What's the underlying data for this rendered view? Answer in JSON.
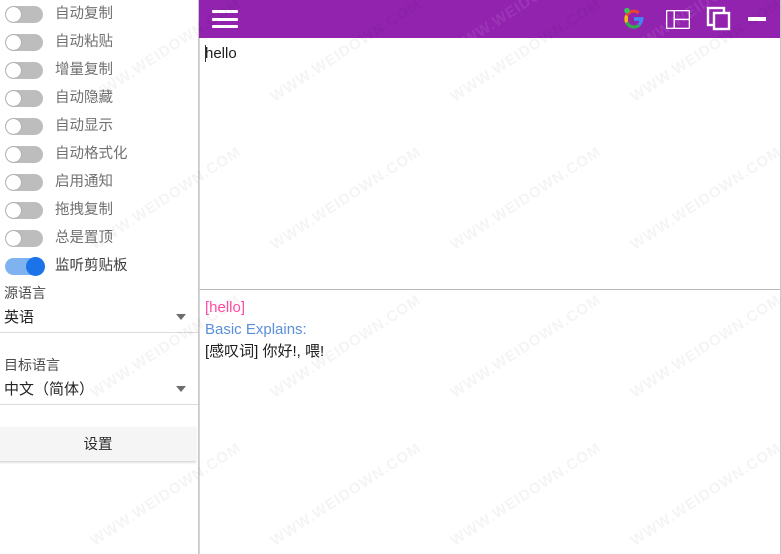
{
  "window": {
    "titlebar": {
      "background_color": "#9223af",
      "menu_icon": "hamburger-menu-icon",
      "google_icon": "google-logo-icon",
      "layout_icon": "layout-panes-icon",
      "copy_icon": "copy-duplicate-icon",
      "minimize_icon": "minimize-icon"
    }
  },
  "sidebar": {
    "toggles": [
      {
        "label": "自动复制",
        "on": false
      },
      {
        "label": "自动粘贴",
        "on": false
      },
      {
        "label": "增量复制",
        "on": false
      },
      {
        "label": "自动隐藏",
        "on": false
      },
      {
        "label": "自动显示",
        "on": false
      },
      {
        "label": "自动格式化",
        "on": false
      },
      {
        "label": "启用通知",
        "on": false
      },
      {
        "label": "拖拽复制",
        "on": false
      },
      {
        "label": "总是置顶",
        "on": false
      },
      {
        "label": "监听剪贴板",
        "on": true
      }
    ],
    "source_language": {
      "label": "源语言",
      "value": "英语"
    },
    "target_language": {
      "label": "目标语言",
      "value": "中文（简体）"
    },
    "settings_button": "设置"
  },
  "main": {
    "input": {
      "text": "hello"
    },
    "result": {
      "headword": "[hello]",
      "headword_color": "#ff4da6",
      "section_title": "Basic Explains:",
      "section_color": "#5b8fdb",
      "definition": "[感叹词] 你好!, 喂!"
    }
  },
  "watermark": {
    "text": "WWW.WEIDOWN.COM"
  }
}
